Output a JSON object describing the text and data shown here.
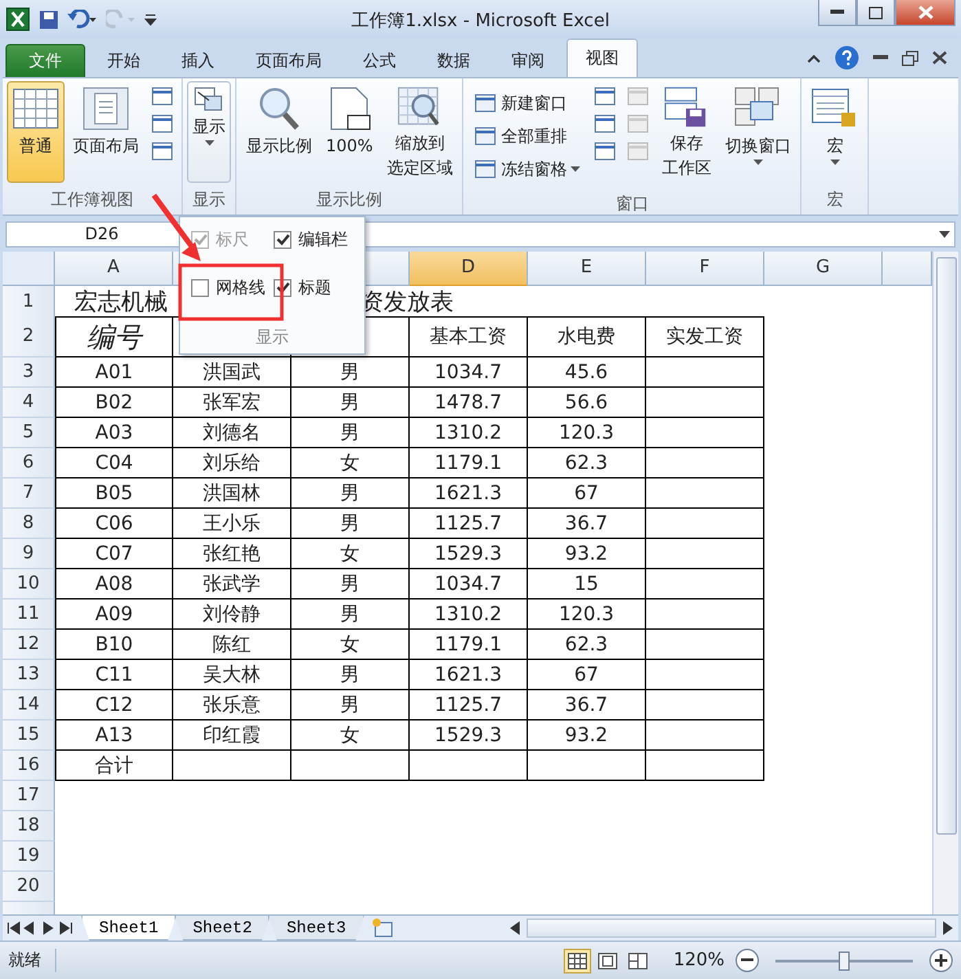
{
  "window": {
    "title": "工作簿1.xlsx - Microsoft Excel"
  },
  "tabs": [
    {
      "label": "文件",
      "kind": "file",
      "selected": false
    },
    {
      "label": "开始",
      "kind": "tab",
      "selected": false
    },
    {
      "label": "插入",
      "kind": "tab",
      "selected": false
    },
    {
      "label": "页面布局",
      "kind": "tab",
      "selected": false
    },
    {
      "label": "公式",
      "kind": "tab",
      "selected": false
    },
    {
      "label": "数据",
      "kind": "tab",
      "selected": false
    },
    {
      "label": "审阅",
      "kind": "tab",
      "selected": false
    },
    {
      "label": "视图",
      "kind": "tab",
      "selected": true
    }
  ],
  "ribbon": {
    "groups": [
      {
        "label": "工作簿视图",
        "items": [
          {
            "kind": "large",
            "lines": [
              "普通"
            ],
            "selected": true
          },
          {
            "kind": "large",
            "lines": [
              "页面布局"
            ],
            "selected": false
          },
          {
            "kind": "icon-column",
            "disabled": false
          }
        ]
      },
      {
        "label": "显示",
        "items": [
          {
            "kind": "large",
            "lines": [
              "显示"
            ],
            "dropdown": true,
            "selected": false,
            "expanded": true
          }
        ]
      },
      {
        "label": "显示比例",
        "items": [
          {
            "kind": "large",
            "lines": [
              "显示比例"
            ],
            "selected": false
          },
          {
            "kind": "large",
            "lines": [
              "100%"
            ],
            "selected": false
          },
          {
            "kind": "large",
            "lines": [
              "缩放到",
              "选定区域"
            ],
            "selected": false
          }
        ]
      },
      {
        "label": "窗口",
        "items": [
          {
            "kind": "small-list",
            "entries": [
              {
                "label": "新建窗口",
                "dropdown": false
              },
              {
                "label": "全部重排",
                "dropdown": false
              },
              {
                "label": "冻结窗格",
                "dropdown": true
              }
            ]
          },
          {
            "kind": "icon-column",
            "disabled": false
          },
          {
            "kind": "icon-column",
            "disabled": true
          },
          {
            "kind": "large",
            "lines": [
              "保存",
              "工作区"
            ],
            "selected": false
          },
          {
            "kind": "large",
            "lines": [
              "切换窗口"
            ],
            "dropdown": true,
            "selected": false
          }
        ]
      },
      {
        "label": "宏",
        "items": [
          {
            "kind": "large",
            "lines": [
              "宏"
            ],
            "dropdown": true,
            "selected": false
          }
        ]
      }
    ]
  },
  "name_box": "D26",
  "display_menu": {
    "label": "显示",
    "options": [
      {
        "label": "标尺",
        "checked": true,
        "disabled": true
      },
      {
        "label": "编辑栏",
        "checked": true,
        "disabled": false
      },
      {
        "label": "网格线",
        "checked": false,
        "disabled": false
      },
      {
        "label": "标题",
        "checked": true,
        "disabled": false
      }
    ]
  },
  "columns": [
    {
      "label": "A",
      "selected": false
    },
    {
      "label": "D",
      "selected": true
    },
    {
      "label": "E",
      "selected": false
    },
    {
      "label": "F",
      "selected": false
    },
    {
      "label": "G",
      "selected": false
    }
  ],
  "rows": [
    {
      "number": "1",
      "kind": "title",
      "left": "宏志机械",
      "right": "资发放表"
    },
    {
      "number": "2",
      "kind": "header",
      "a": "编号",
      "d": "基本工资",
      "e": "水电费",
      "f": "实发工资"
    },
    {
      "number": "3",
      "kind": "data",
      "cells": [
        "A01",
        "洪国武",
        "男",
        "1034.7",
        "45.6"
      ]
    },
    {
      "number": "4",
      "kind": "data",
      "cells": [
        "B02",
        "张军宏",
        "男",
        "1478.7",
        "56.6"
      ]
    },
    {
      "number": "5",
      "kind": "data",
      "cells": [
        "A03",
        "刘德名",
        "男",
        "1310.2",
        "120.3"
      ]
    },
    {
      "number": "6",
      "kind": "data",
      "cells": [
        "C04",
        "刘乐给",
        "女",
        "1179.1",
        "62.3"
      ]
    },
    {
      "number": "7",
      "kind": "data",
      "cells": [
        "B05",
        "洪国林",
        "男",
        "1621.3",
        "67"
      ]
    },
    {
      "number": "8",
      "kind": "data",
      "cells": [
        "C06",
        "王小乐",
        "男",
        "1125.7",
        "36.7"
      ]
    },
    {
      "number": "9",
      "kind": "data",
      "cells": [
        "C07",
        "张红艳",
        "女",
        "1529.3",
        "93.2"
      ]
    },
    {
      "number": "10",
      "kind": "data",
      "cells": [
        "A08",
        "张武学",
        "男",
        "1034.7",
        "15"
      ]
    },
    {
      "number": "11",
      "kind": "data",
      "cells": [
        "A09",
        "刘伶静",
        "男",
        "1310.2",
        "120.3"
      ]
    },
    {
      "number": "12",
      "kind": "data",
      "cells": [
        "B10",
        "陈红",
        "女",
        "1179.1",
        "62.3"
      ]
    },
    {
      "number": "13",
      "kind": "data",
      "cells": [
        "C11",
        "吴大林",
        "男",
        "1621.3",
        "67"
      ]
    },
    {
      "number": "14",
      "kind": "data",
      "cells": [
        "C12",
        "张乐意",
        "男",
        "1125.7",
        "36.7"
      ]
    },
    {
      "number": "15",
      "kind": "data",
      "cells": [
        "A13",
        "印红霞",
        "女",
        "1529.3",
        "93.2"
      ]
    },
    {
      "number": "16",
      "kind": "data",
      "cells": [
        "合计"
      ]
    },
    {
      "number": "17",
      "kind": "blank"
    },
    {
      "number": "18",
      "kind": "blank"
    },
    {
      "number": "19",
      "kind": "blank"
    },
    {
      "number": "20",
      "kind": "blank"
    }
  ],
  "sheet_tabs": [
    {
      "label": "Sheet1",
      "selected": true
    },
    {
      "label": "Sheet2",
      "selected": false
    },
    {
      "label": "Sheet3",
      "selected": false
    }
  ],
  "status_bar": {
    "state": "就绪",
    "zoom": "120%",
    "level": 0.5
  }
}
